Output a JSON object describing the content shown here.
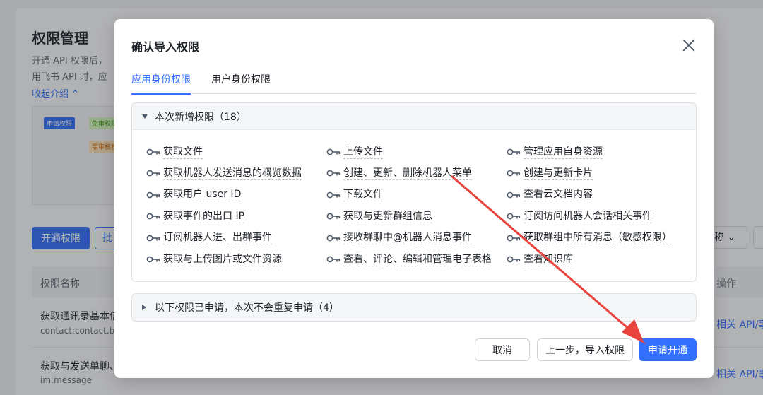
{
  "background": {
    "title": "权限管理",
    "desc_line1": "开通 API 权限后，",
    "desc_line2": "用飞书 API 时，应",
    "collapse_link": "收起介绍",
    "diagram_chips": [
      "申请权限",
      "免审权限",
      "需审核权"
    ],
    "btn_enable": "开通权限",
    "btn_batch": "批",
    "select_label": "称",
    "table_col_name": "权限名称",
    "table_col_action": "操作",
    "rows": [
      {
        "title": "获取通讯录基本信",
        "sub": "contact:contact.b",
        "link": "相关 API/事"
      },
      {
        "title": "获取与发送单聊、",
        "sub": "im:message",
        "link": "相关 API/事"
      }
    ]
  },
  "modal": {
    "title": "确认导入权限",
    "tabs": [
      {
        "label": "应用身份权限",
        "active": true
      },
      {
        "label": "用户身份权限",
        "active": false
      }
    ],
    "new_section_header": "本次新增权限（18）",
    "permissions": [
      "获取文件",
      "上传文件",
      "管理应用自身资源",
      "获取机器人发送消息的概览数据",
      "创建、更新、删除机器人菜单",
      "创建与更新卡片",
      "获取用户 user ID",
      "下载文件",
      "查看云文档内容",
      "获取事件的出口 IP",
      "获取与更新群组信息",
      "订阅访问机器人会话相关事件",
      "订阅机器人进、出群事件",
      "接收群聊中@机器人消息事件",
      "获取群组中所有消息（敏感权限）",
      "获取与上传图片或文件资源",
      "查看、评论、编辑和管理电子表格",
      "查看知识库"
    ],
    "applied_section_header": "以下权限已申请，本次不会重复申请（4）",
    "buttons": {
      "cancel": "取消",
      "prev": "上一步，导入权限",
      "submit": "申请开通"
    }
  },
  "colors": {
    "primary": "#3370ff",
    "annotation_arrow": "#e8433d"
  }
}
